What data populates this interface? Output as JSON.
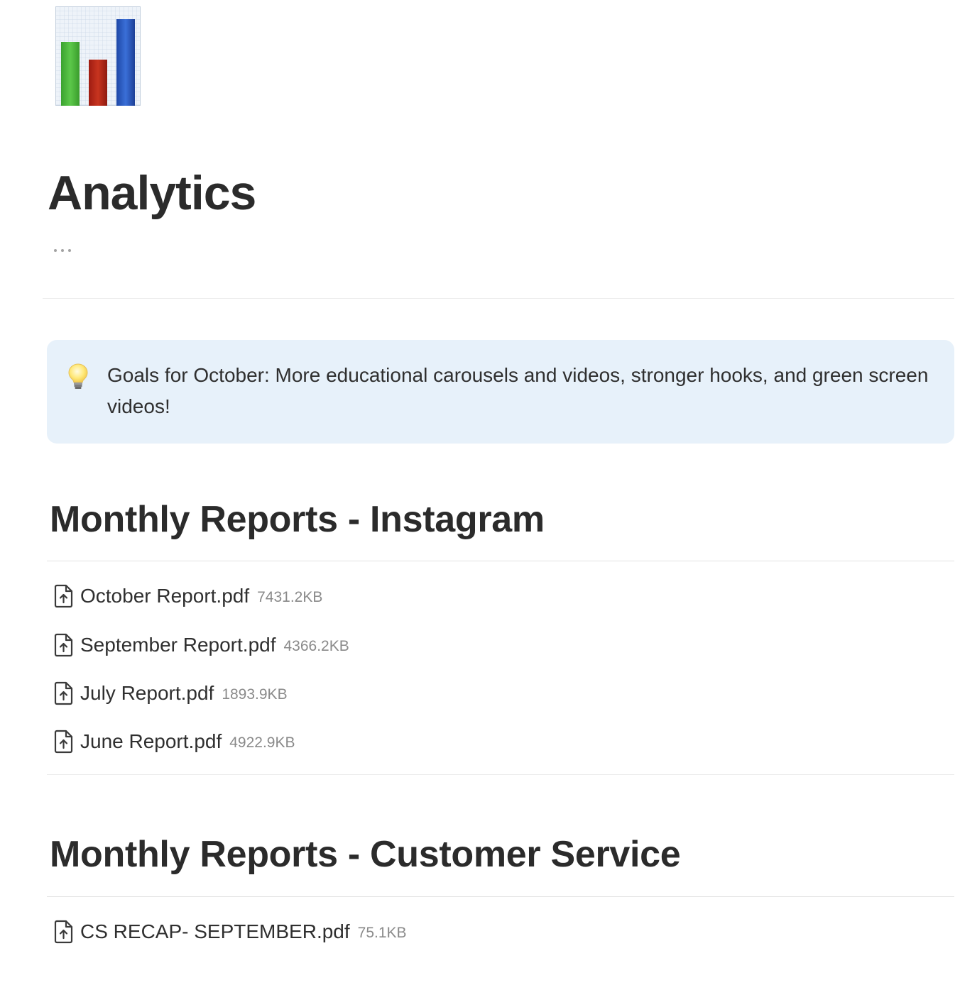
{
  "page": {
    "icon": "bar-chart-icon",
    "title": "Analytics",
    "more_icon": "more-horizontal-icon"
  },
  "callout": {
    "icon": "light-bulb-icon",
    "text": "Goals for October: More educational carousels and videos, stronger hooks, and green screen videos!",
    "background": "#e7f1fa"
  },
  "sections": [
    {
      "heading": "Monthly Reports - Instagram",
      "files": [
        {
          "name": "October Report.pdf",
          "size": "7431.2KB",
          "icon": "file-upload-icon"
        },
        {
          "name": "September Report.pdf",
          "size": "4366.2KB",
          "icon": "file-upload-icon"
        },
        {
          "name": "July Report.pdf",
          "size": "1893.9KB",
          "icon": "file-upload-icon"
        },
        {
          "name": "June Report.pdf",
          "size": "4922.9KB",
          "icon": "file-upload-icon"
        }
      ]
    },
    {
      "heading": "Monthly Reports - Customer Service",
      "files": [
        {
          "name": "CS RECAP- SEPTEMBER.pdf",
          "size": "75.1KB",
          "icon": "file-upload-icon"
        }
      ]
    }
  ]
}
